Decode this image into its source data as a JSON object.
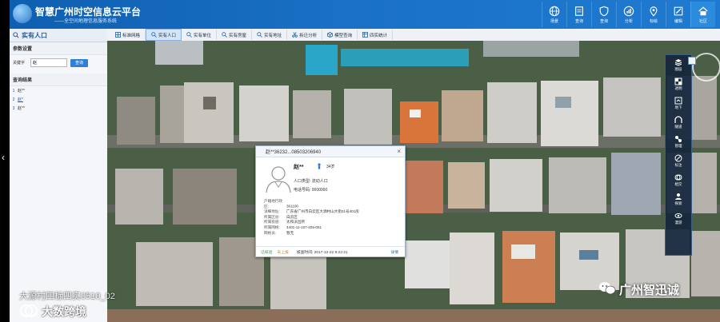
{
  "app": {
    "title": "智慧广州时空信息云平台",
    "subtitle": "——全空间地理信息服务系统"
  },
  "topnav": [
    {
      "label": "场景",
      "icon": "globe-icon"
    },
    {
      "label": "查询",
      "icon": "document-icon"
    },
    {
      "label": "查询",
      "icon": "shield-icon"
    },
    {
      "label": "分析",
      "icon": "chart-globe-icon"
    },
    {
      "label": "标绘",
      "icon": "pin-icon"
    },
    {
      "label": "编辑",
      "icon": "edit-icon"
    },
    {
      "label": "社区",
      "icon": "home-icon"
    }
  ],
  "left_panel": {
    "title": "实有人口",
    "params_section": "参数设置",
    "keyword_label": "关键字",
    "keyword_value": "赵",
    "query_button": "查询",
    "results_section": "查询结果",
    "results": [
      {
        "idx": "1",
        "text": "赵**"
      },
      {
        "idx": "2",
        "text": "赵*"
      },
      {
        "idx": "3",
        "text": "赵**"
      }
    ]
  },
  "toolbar": [
    {
      "label": "标准网格",
      "icon": "grid-icon",
      "active": false
    },
    {
      "label": "实有人口",
      "icon": "search-icon",
      "active": true
    },
    {
      "label": "实有单位",
      "icon": "search-icon",
      "active": false
    },
    {
      "label": "实有房屋",
      "icon": "search-icon",
      "active": false
    },
    {
      "label": "实有地址",
      "icon": "search-icon",
      "active": false
    },
    {
      "label": "拆迁分析",
      "icon": "scissors-icon",
      "active": false
    },
    {
      "label": "模型查询",
      "icon": "cube-icon",
      "active": false
    },
    {
      "label": "四实统计",
      "icon": "table-icon",
      "active": false
    }
  ],
  "popup": {
    "header": "赵**36232...08503206940",
    "close": "×",
    "name": "赵**",
    "age": "34岁",
    "type_line": "人口类型: 流动人口",
    "phone_line": "电话号码: 0000000",
    "details": [
      {
        "k": "户籍地行政区:",
        "v": "361100"
      },
      {
        "k": "详细地址:",
        "v": "广东省广州市白云区大源村山大街31号401房"
      },
      {
        "k": "所属区县:",
        "v": "白云区"
      },
      {
        "k": "所属街道:",
        "v": "太和派出所"
      },
      {
        "k": "所属网格:",
        "v": "4401-11-107-205-051"
      },
      {
        "k": "网格员:",
        "v": "暂无"
      }
    ],
    "footer": {
      "status1": "已核验",
      "status2": "未上报",
      "time": "核查时间: 2017-12-22 9:22:21",
      "detail": "详情"
    }
  },
  "rightbar": [
    {
      "label": "图层",
      "icon": "layers-icon"
    },
    {
      "label": "透明",
      "icon": "transparency-icon"
    },
    {
      "label": "地下",
      "icon": "underground-icon"
    },
    {
      "label": "隧道",
      "icon": "tunnel-icon"
    },
    {
      "label": "管理",
      "icon": "manage-icon"
    },
    {
      "label": "标注",
      "icon": "label-icon"
    },
    {
      "label": "相交",
      "icon": "intersect-icon"
    },
    {
      "label": "探索",
      "icon": "explore-icon"
    },
    {
      "label": "漫游",
      "icon": "roam-icon"
    }
  ],
  "overlay": {
    "left_arrow": "‹",
    "watermark_top": "大源村四标四实0510_02",
    "watermark_bottom": "大数跨境",
    "brand": "广州智迅诚"
  },
  "colors": {
    "header_blue": "#1b73c8",
    "accent": "#2f7fd2",
    "status_green": "#2aa24a",
    "status_orange": "#e08a10"
  }
}
